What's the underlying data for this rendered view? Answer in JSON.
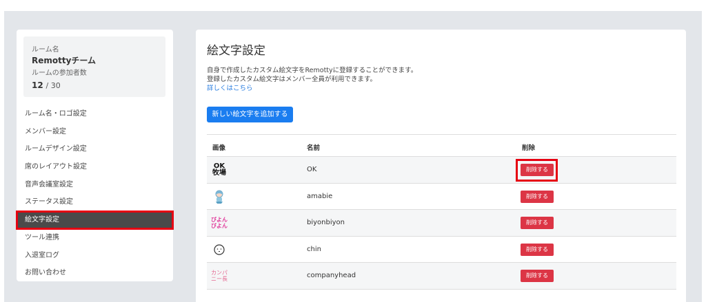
{
  "sidebar": {
    "room_name_label": "ルーム名",
    "room_name": "Remottyチーム",
    "members_label": "ルームの参加者数",
    "members_count": "12",
    "members_max": "/ 30",
    "items": [
      {
        "label": "ルーム名・ロゴ設定"
      },
      {
        "label": "メンバー設定"
      },
      {
        "label": "ルームデザイン設定"
      },
      {
        "label": "席のレイアウト設定"
      },
      {
        "label": "音声会議室設定"
      },
      {
        "label": "ステータス設定"
      },
      {
        "label": "絵文字設定"
      },
      {
        "label": "ツール連携"
      },
      {
        "label": "入退室ログ"
      },
      {
        "label": "お問い合わせ"
      }
    ]
  },
  "main": {
    "title": "絵文字設定",
    "desc_line1": "自身で作成したカスタム絵文字をRemottyに登録することができます。",
    "desc_line2": "登録したカスタム絵文字はメンバー全員が利用できます。",
    "details_link": "詳しくはこちら",
    "add_button": "新しい絵文字を追加する",
    "table": {
      "headers": {
        "image": "画像",
        "name": "名前",
        "delete": "削除"
      },
      "delete_label": "削除する",
      "rows": [
        {
          "name": "OK",
          "emoji_text": "OK\n牧場"
        },
        {
          "name": "amabie",
          "emoji_icon": "amabie-icon"
        },
        {
          "name": "biyonbiyon",
          "emoji_text": "びよん\nびよん"
        },
        {
          "name": "chin",
          "emoji_icon": "face-icon"
        },
        {
          "name": "companyhead",
          "emoji_text": "カンパ\nニー長"
        }
      ]
    }
  }
}
